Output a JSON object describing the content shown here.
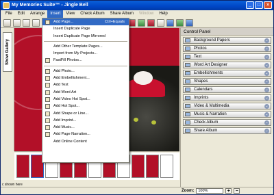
{
  "window": {
    "title": "My Memories Suite™ - Jingle Bell"
  },
  "menubar": [
    "File",
    "Edit",
    "Arrange",
    "Insert",
    "View",
    "Check Album",
    "Share Album",
    "Window",
    "Help"
  ],
  "sidebar": {
    "gallery_tab": "Show Gallery"
  },
  "insert_menu": {
    "group1": [
      {
        "label": "Add Page...",
        "shortcut": "Ctrl+Equals"
      },
      {
        "label": "Insert Duplicate Page"
      },
      {
        "label": "Insert Duplicate Page Mirrored"
      }
    ],
    "group2": [
      {
        "label": "Add Other Template Pages..."
      },
      {
        "label": "Import from My Projects..."
      },
      {
        "label": "FastFill Photos..."
      }
    ],
    "group3": [
      {
        "label": "Add Photo..."
      },
      {
        "label": "Add Embellishment..."
      },
      {
        "label": "Add Text"
      },
      {
        "label": "Add Word Art"
      },
      {
        "label": "Add Video Hot Spot..."
      },
      {
        "label": "Add Hot Spot..."
      },
      {
        "label": "Add Shape or Line..."
      },
      {
        "label": "Add Imprint..."
      },
      {
        "label": "Add Music..."
      },
      {
        "label": "Add Page Narration..."
      },
      {
        "label": "Add Online Content"
      }
    ]
  },
  "control_panel": {
    "title": "Control Panel",
    "items": [
      "Background Papers",
      "Photos",
      "Text",
      "Word Art Designer",
      "Embellishments",
      "Shapes",
      "Calendars",
      "Imprints",
      "Video & Multimedia",
      "Music & Narration",
      "Check Album",
      "Share Album"
    ]
  },
  "zoom": {
    "label": "Zoom:",
    "value": "100%"
  },
  "status": {
    "shown_text": "c shown here"
  },
  "colors": {
    "accent": "#316ac5",
    "title_bar": "#0046c6",
    "canvas_red": "#b21028"
  }
}
